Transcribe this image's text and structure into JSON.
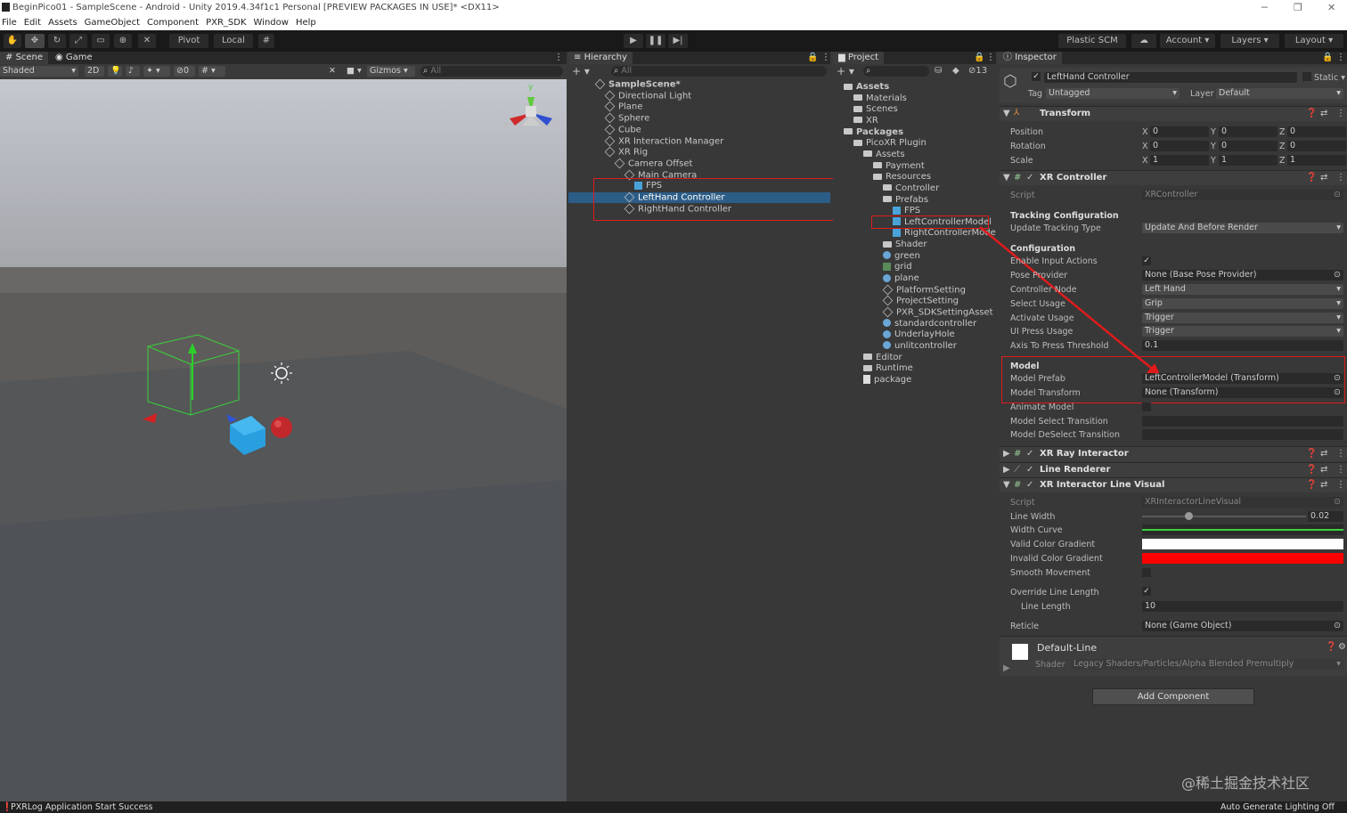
{
  "window": {
    "title": "BeginPico01 - SampleScene - Android - Unity 2019.4.34f1c1 Personal [PREVIEW PACKAGES IN USE]* <DX11>",
    "min": "─",
    "max": "❐",
    "close": "✕"
  },
  "menu": [
    "File",
    "Edit",
    "Assets",
    "GameObject",
    "Component",
    "PXR_SDK",
    "Window",
    "Help"
  ],
  "toolbar": {
    "pivot": "Pivot",
    "local": "Local",
    "plastic": "Plastic SCM",
    "account": "Account",
    "layers": "Layers",
    "layout": "Layout"
  },
  "scene": {
    "tab_scene": "Scene",
    "tab_game": "Game",
    "shading": "Shaded",
    "mode2d": "2D",
    "fx_count": "0",
    "gizmos": "Gizmos",
    "search_placeholder": "All",
    "gizmo_y": "y",
    "gizmo_x": "x",
    "gizmo_z": "z"
  },
  "hierarchy": {
    "tab": "Hierarchy",
    "search_placeholder": "All",
    "items": [
      {
        "label": "SampleScene*",
        "depth": 0,
        "kind": "scene"
      },
      {
        "label": "Directional Light",
        "depth": 1
      },
      {
        "label": "Plane",
        "depth": 1
      },
      {
        "label": "Sphere",
        "depth": 1
      },
      {
        "label": "Cube",
        "depth": 1
      },
      {
        "label": "XR Interaction Manager",
        "depth": 1
      },
      {
        "label": "XR Rig",
        "depth": 1
      },
      {
        "label": "Camera Offset",
        "depth": 2
      },
      {
        "label": "Main Camera",
        "depth": 3
      },
      {
        "label": "FPS",
        "depth": 4,
        "kind": "prefab"
      },
      {
        "label": "LeftHand Controller",
        "depth": 3,
        "selected": true
      },
      {
        "label": "RightHand Controller",
        "depth": 3
      }
    ]
  },
  "project": {
    "tab": "Project",
    "hidden_count": "13",
    "items": [
      {
        "label": "Assets",
        "depth": 0,
        "bold": true
      },
      {
        "label": "Materials",
        "depth": 1
      },
      {
        "label": "Scenes",
        "depth": 1
      },
      {
        "label": "XR",
        "depth": 1
      },
      {
        "label": "Packages",
        "depth": 0,
        "bold": true
      },
      {
        "label": "PicoXR Plugin",
        "depth": 1
      },
      {
        "label": "Assets",
        "depth": 2
      },
      {
        "label": "Payment",
        "depth": 3
      },
      {
        "label": "Resources",
        "depth": 3
      },
      {
        "label": "Controller",
        "depth": 4
      },
      {
        "label": "Prefabs",
        "depth": 4
      },
      {
        "label": "FPS",
        "depth": 5,
        "kind": "prefab"
      },
      {
        "label": "LeftControllerModel",
        "depth": 5,
        "kind": "prefab"
      },
      {
        "label": "RightControllerModel",
        "depth": 5,
        "kind": "prefab"
      },
      {
        "label": "Shader",
        "depth": 4
      },
      {
        "label": "green",
        "depth": 4,
        "kind": "mat"
      },
      {
        "label": "grid",
        "depth": 4,
        "kind": "tex"
      },
      {
        "label": "plane",
        "depth": 4,
        "kind": "mat"
      },
      {
        "label": "PlatformSetting",
        "depth": 4,
        "kind": "go"
      },
      {
        "label": "ProjectSetting",
        "depth": 4,
        "kind": "go"
      },
      {
        "label": "PXR_SDKSettingAsset",
        "depth": 4,
        "kind": "go"
      },
      {
        "label": "standardcontroller",
        "depth": 4,
        "kind": "mat"
      },
      {
        "label": "UnderlayHole",
        "depth": 4,
        "kind": "mat"
      },
      {
        "label": "unlitcontroller",
        "depth": 4,
        "kind": "mat"
      },
      {
        "label": "Editor",
        "depth": 2
      },
      {
        "label": "Runtime",
        "depth": 2
      },
      {
        "label": "package",
        "depth": 2,
        "kind": "file"
      }
    ]
  },
  "inspector": {
    "tab": "Inspector",
    "object_name": "LeftHand Controller",
    "static": "Static",
    "tag_label": "Tag",
    "tag_value": "Untagged",
    "layer_label": "Layer",
    "layer_value": "Default",
    "transform": {
      "title": "Transform",
      "position_label": "Position",
      "rotation_label": "Rotation",
      "scale_label": "Scale",
      "x": "X",
      "y": "Y",
      "z": "Z",
      "position": [
        "0",
        "0",
        "0"
      ],
      "rotation": [
        "0",
        "0",
        "0"
      ],
      "scale": [
        "1",
        "1",
        "1"
      ]
    },
    "xr_controller": {
      "title": "XR Controller",
      "script_label": "Script",
      "script_value": "XRController",
      "tracking_header": "Tracking Configuration",
      "update_tracking_label": "Update Tracking Type",
      "update_tracking_value": "Update And Before Render",
      "config_header": "Configuration",
      "enable_input_label": "Enable Input Actions",
      "pose_provider_label": "Pose Provider",
      "pose_provider_value": "None (Base Pose Provider)",
      "controller_node_label": "Controller Node",
      "controller_node_value": "Left Hand",
      "select_usage_label": "Select Usage",
      "select_usage_value": "Grip",
      "activate_usage_label": "Activate Usage",
      "activate_usage_value": "Trigger",
      "ui_press_label": "UI Press Usage",
      "ui_press_value": "Trigger",
      "axis_threshold_label": "Axis To Press Threshold",
      "axis_threshold_value": "0.1",
      "model_header": "Model",
      "model_prefab_label": "Model Prefab",
      "model_prefab_value": "LeftControllerModel (Transform)",
      "model_transform_label": "Model Transform",
      "model_transform_value": "None (Transform)",
      "animate_model_label": "Animate Model",
      "model_select_label": "Model Select Transition",
      "model_deselect_label": "Model DeSelect Transition"
    },
    "xr_ray": {
      "title": "XR Ray Interactor"
    },
    "line_renderer": {
      "title": "Line Renderer"
    },
    "line_visual": {
      "title": "XR Interactor Line Visual",
      "script_label": "Script",
      "script_value": "XRInteractorLineVisual",
      "line_width_label": "Line Width",
      "line_width_value": "0.02",
      "line_width_fraction": 0.28,
      "width_curve_label": "Width Curve",
      "valid_gradient_label": "Valid Color Gradient",
      "valid_color": "#ffffff",
      "invalid_gradient_label": "Invalid Color Gradient",
      "invalid_color": "#ff0000",
      "smooth_label": "Smooth Movement",
      "override_label": "Override Line Length",
      "line_length_label": "Line Length",
      "line_length_value": "10",
      "reticle_label": "Reticle",
      "reticle_value": "None (Game Object)"
    },
    "material": {
      "name": "Default-Line",
      "shader_label": "Shader",
      "shader_value": "Legacy Shaders/Particles/Alpha Blended Premultiply"
    },
    "add_component": "Add Component"
  },
  "watermark": "@稀土掘金技术社区",
  "status": {
    "left": "PXRLog Application Start Success",
    "right": "Auto Generate Lighting Off"
  },
  "colors": {
    "highlight": "#e01b1b",
    "selection": "#2c5d87",
    "accent_prefab": "#4aa3d8"
  }
}
